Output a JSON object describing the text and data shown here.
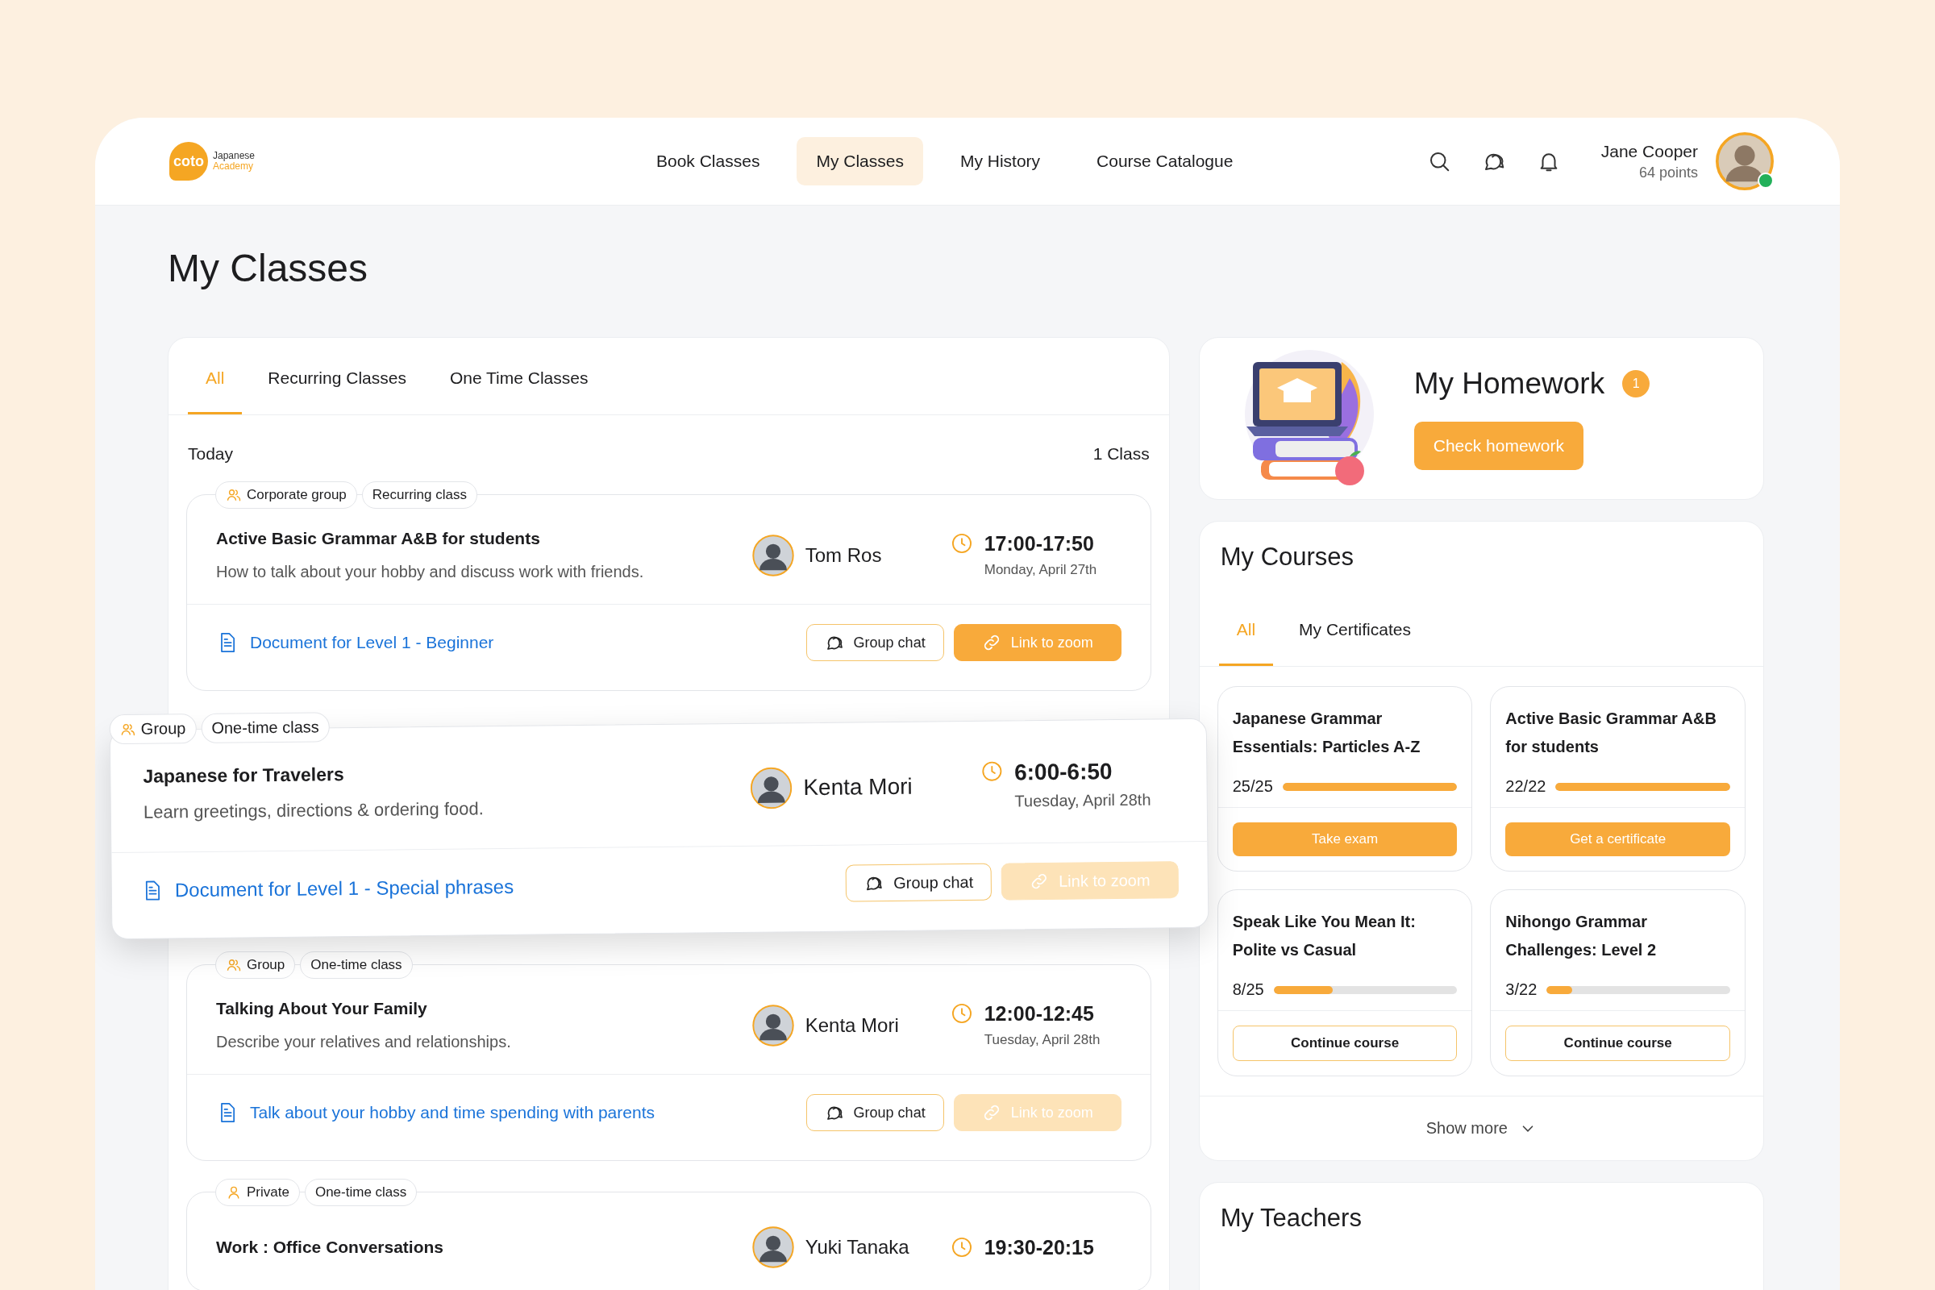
{
  "header": {
    "logo": {
      "mark": "coto",
      "line1": "Japanese",
      "line2": "Academy"
    },
    "nav": [
      {
        "label": "Book Classes",
        "selected": false
      },
      {
        "label": "My Classes",
        "selected": true
      },
      {
        "label": "My History",
        "selected": false
      },
      {
        "label": "Course Catalogue",
        "selected": false
      }
    ],
    "user": {
      "name": "Jane Cooper",
      "points": "64 points",
      "online": true
    }
  },
  "page_title": "My Classes",
  "classes_panel": {
    "tabs": [
      {
        "label": "All",
        "selected": true
      },
      {
        "label": "Recurring Classes",
        "selected": false
      },
      {
        "label": "One Time Classes",
        "selected": false
      }
    ],
    "day_label": "Today",
    "count": "1 Class",
    "classes": [
      {
        "tags": [
          {
            "label": "Corporate group",
            "kind": "group"
          },
          {
            "label": "Recurring class",
            "kind": "format"
          }
        ],
        "title": "Active Basic Grammar A&B for students",
        "description": "How to talk about your hobby and discuss work with friends.",
        "teacher": "Tom Ros",
        "time": "17:00-17:50",
        "date": "Monday, April 27th",
        "document": "Document for Level 1 - Beginner",
        "chat": "Group chat",
        "zoom": {
          "label": "Link to zoom",
          "disabled": false
        },
        "elevated": false
      },
      {
        "tags": [
          {
            "label": "Group",
            "kind": "group"
          },
          {
            "label": "One-time class",
            "kind": "format"
          }
        ],
        "title": "Japanese for Travelers",
        "description": "Learn greetings, directions & ordering food.",
        "teacher": "Kenta Mori",
        "time": "6:00-6:50",
        "date": "Tuesday, April 28th",
        "document": "Document for Level 1 - Special phrases",
        "chat": "Group chat",
        "zoom": {
          "label": "Link to zoom",
          "disabled": true
        },
        "elevated": true
      },
      {
        "tags": [
          {
            "label": "Group",
            "kind": "group"
          },
          {
            "label": "One-time class",
            "kind": "format"
          }
        ],
        "title": "Talking About Your Family",
        "description": "Describe your relatives and relationships.",
        "teacher": "Kenta Mori",
        "time": "12:00-12:45",
        "date": "Tuesday, April 28th",
        "document": "Talk about your hobby and time spending with parents",
        "chat": "Group chat",
        "zoom": {
          "label": "Link to zoom",
          "disabled": true
        },
        "elevated": false
      },
      {
        "tags": [
          {
            "label": "Private",
            "kind": "private"
          },
          {
            "label": "One-time class",
            "kind": "format"
          }
        ],
        "title": "Work : Office Conversations",
        "teacher": "Yuki Tanaka",
        "time": "19:30-20:15",
        "elevated": false
      }
    ]
  },
  "homework": {
    "title": "My Homework",
    "badge": "1",
    "button": "Check homework"
  },
  "courses": {
    "title": "My Courses",
    "tabs": [
      {
        "label": "All",
        "selected": true
      },
      {
        "label": "My Certificates",
        "selected": false
      }
    ],
    "items": [
      {
        "title": "Japanese Grammar Essentials: Particles A-Z",
        "progress": "25/25",
        "level": 1,
        "action": {
          "label": "Take exam",
          "kind": "primary"
        }
      },
      {
        "title": "Active Basic Grammar A&B for students",
        "progress": "22/22",
        "level": 1,
        "action": {
          "label": "Get a certificate",
          "kind": "primary"
        }
      },
      {
        "title": "Speak Like You Mean It: Polite vs Casual",
        "progress": "8/25",
        "level": 0.32,
        "action": {
          "label": "Continue course",
          "kind": "outline"
        }
      },
      {
        "title": "Nihongo Grammar Challenges: Level 2",
        "progress": "3/22",
        "level": 0.14,
        "action": {
          "label": "Continue course",
          "kind": "outline"
        }
      }
    ],
    "show_more": "Show more"
  },
  "teachers": {
    "title": "My Teachers"
  }
}
